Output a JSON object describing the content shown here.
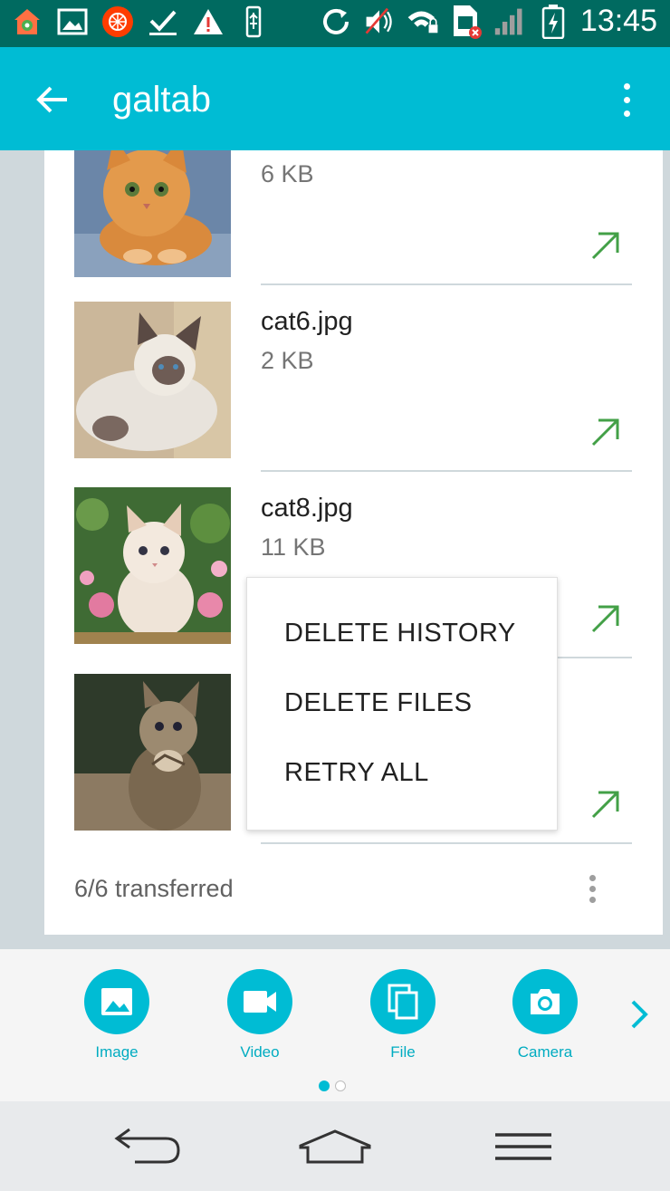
{
  "status_bar": {
    "time": "13:45",
    "icons": [
      "home-settings-icon",
      "gallery-icon",
      "app-icon",
      "download-done-icon",
      "warning-icon",
      "usb-icon",
      "sync-icon",
      "volume-muted-icon",
      "wifi-locked-icon",
      "sim-error-icon",
      "signal-icon",
      "battery-charging-icon"
    ]
  },
  "app_bar": {
    "title": "galtab",
    "back_icon": "arrow-back-icon",
    "menu_icon": "more-vert-icon"
  },
  "files": [
    {
      "name": "",
      "size": "6 KB",
      "thumb": "orange-kitten"
    },
    {
      "name": "cat6.jpg",
      "size": "2 KB",
      "thumb": "siamese-cat"
    },
    {
      "name": "cat8.jpg",
      "size": "11 KB",
      "thumb": "white-kitten-flowers"
    },
    {
      "name": "",
      "size": "",
      "thumb": "tabby-kitten-praying"
    }
  ],
  "footer": {
    "status": "6/6 transferred"
  },
  "popup_menu": {
    "items": [
      "DELETE HISTORY",
      "DELETE FILES",
      "RETRY ALL"
    ]
  },
  "attach_bar": {
    "items": [
      {
        "label": "Image",
        "icon": "image-icon"
      },
      {
        "label": "Video",
        "icon": "videocam-icon"
      },
      {
        "label": "File",
        "icon": "file-copy-icon"
      },
      {
        "label": "Camera",
        "icon": "camera-icon"
      }
    ],
    "pages": 2,
    "active_page": 1
  },
  "colors": {
    "accent": "#00bcd4",
    "status_bar": "#006a60",
    "open_icon": "#43a047"
  }
}
